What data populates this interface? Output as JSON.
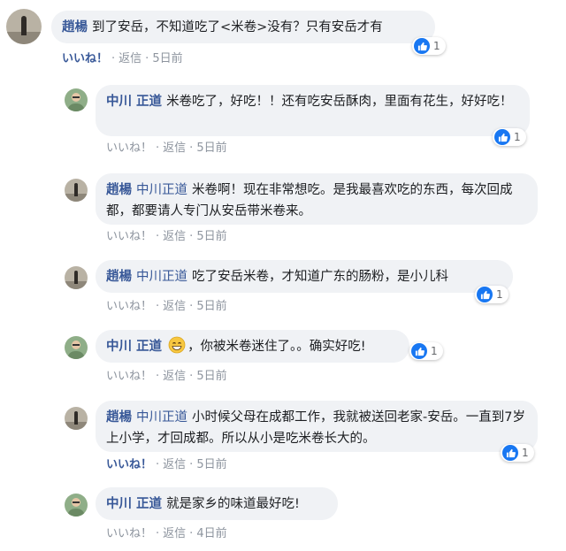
{
  "comments": [
    {
      "author": "趙楊",
      "mention": "",
      "text": "到了安岳，不知道吃了<米卷>没有？只有安岳才有",
      "like_label": "いいね！",
      "reply_label": "返信",
      "time": "5日前",
      "reaction_count": "1"
    },
    {
      "author": "中川 正道",
      "mention": "",
      "text": "米卷吃了，好吃！！还有吃安岳酥肉，里面有花生，好好吃！",
      "like_label": "いいね！",
      "reply_label": "返信",
      "time": "5日前",
      "reaction_count": "1"
    },
    {
      "author": "趙楊",
      "mention": "中川正道",
      "text": "米卷啊！现在非常想吃。是我最喜欢吃的东西，每次回成都，都要请人专门从安岳带米卷来。",
      "like_label": "いいね！",
      "reply_label": "返信",
      "time": "5日前",
      "reaction_count": ""
    },
    {
      "author": "趙楊",
      "mention": "中川正道",
      "text": "吃了安岳米卷，才知道广东的肠粉，是小儿科",
      "like_label": "いいね！",
      "reply_label": "返信",
      "time": "5日前",
      "reaction_count": "1"
    },
    {
      "author": "中川 正道",
      "mention": "",
      "text_after_emoji": "，你被米卷迷住了。。确实好吃!",
      "like_label": "いいね！",
      "reply_label": "返信",
      "time": "5日前",
      "reaction_count": "1"
    },
    {
      "author": "趙楊",
      "mention": "中川正道",
      "text": "小时候父母在成都工作，我就被送回老家-安岳。一直到7岁上小学，才回成都。所以从小是吃米卷长大的。",
      "like_label": "いいね！",
      "reply_label": "返信",
      "time": "5日前",
      "reaction_count": "1"
    },
    {
      "author": "中川 正道",
      "mention": "",
      "text": "就是家乡的味道最好吃!",
      "like_label": "いいね！",
      "reply_label": "返信",
      "time": "4日前",
      "reaction_count": ""
    }
  ],
  "colors": {
    "link_blue": "#385898",
    "bubble_bg": "#f0f2f5",
    "reaction_blue": "#1877f2",
    "meta_gray": "#8d949e"
  },
  "icons": {
    "like_reaction": "thumbs-up-icon",
    "emoji": "grinning-face-icon"
  }
}
